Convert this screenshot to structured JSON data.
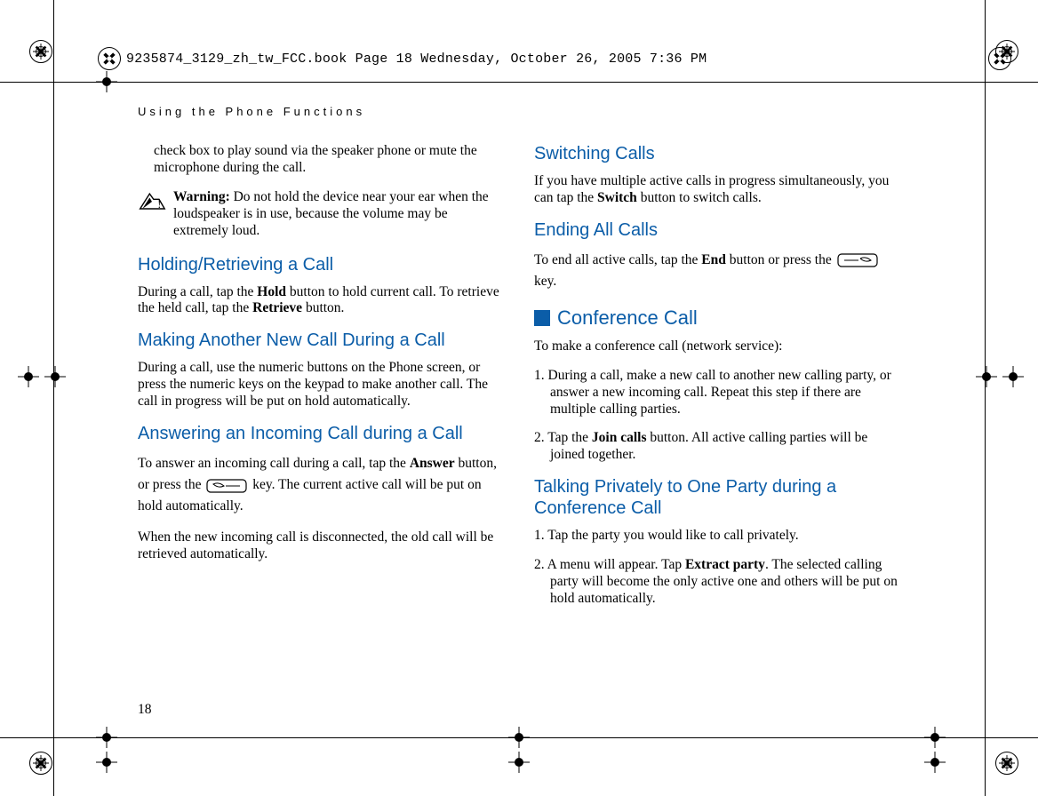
{
  "print_header": "9235874_3129_zh_tw_FCC.book  Page 18  Wednesday, October 26, 2005  7:36 PM",
  "running_head": "Using the Phone Functions",
  "page_number": "18",
  "left": {
    "p1": "check box to play sound via the speaker phone or mute the microphone during the call.",
    "warn_label": "Warning:",
    "warn_text": " Do not hold the device near your ear when the loudspeaker is in use, because the volume may be extremely loud.",
    "h_holding": "Holding/Retrieving a Call",
    "p_holding_a": "During a call, tap the ",
    "p_holding_hold": "Hold",
    "p_holding_b": " button to hold current call. To retrieve the held call, tap the ",
    "p_holding_retrieve": "Retrieve",
    "p_holding_c": " button.",
    "h_making": "Making Another New Call During a Call",
    "p_making": "During a call, use the numeric buttons on the Phone screen, or press the numeric keys on the keypad to make another call. The call in progress will be put on hold automatically.",
    "h_answering": "Answering an Incoming Call during a Call",
    "p_ans_a": "To answer an incoming call during a call, tap the ",
    "p_ans_answer": "Answer",
    "p_ans_b": " button, or press the ",
    "p_ans_c": " key. The current active call will be put on hold automatically.",
    "p_ans_d": "When the new incoming call is disconnected, the old call will be retrieved automatically."
  },
  "right": {
    "h_switch": "Switching Calls",
    "p_switch_a": "If you have multiple active calls in progress simultaneously, you can tap the ",
    "p_switch_bold": "Switch",
    "p_switch_b": " button to switch calls.",
    "h_endall": "Ending All Calls",
    "p_end_a": "To end all active calls, tap the ",
    "p_end_bold": "End",
    "p_end_b": " button or press the ",
    "p_end_c": "key.",
    "h_conf": "Conference Call",
    "p_conf_intro": "To make a conference call (network service):",
    "p_conf_1": "1. During a call, make a new call to another new calling party, or answer a new incoming call. Repeat this step if there are multiple calling parties.",
    "p_conf_2a": "2. Tap the ",
    "p_conf_2_bold": "Join calls",
    "p_conf_2b": " button. All active calling parties will be joined together.",
    "h_talk": "Talking Privately to One Party during a Conference Call",
    "p_talk_1": "1. Tap the party you would like to call privately.",
    "p_talk_2a": "2. A menu will appear. Tap ",
    "p_talk_2_bold": "Extract party",
    "p_talk_2b": ". The selected calling party will become the only active one and others will be put on hold automatically."
  }
}
